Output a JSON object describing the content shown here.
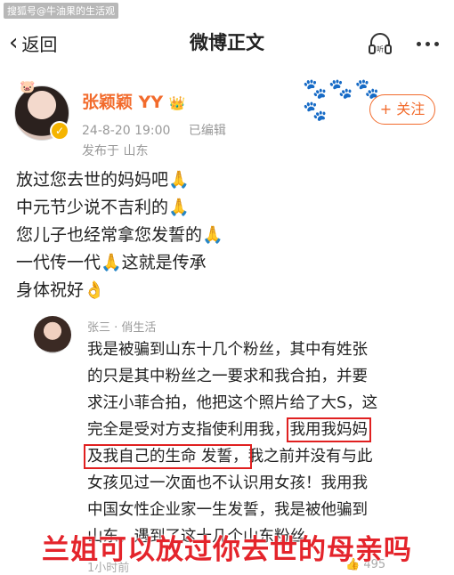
{
  "watermark": "搜狐号@牛油果的生活观",
  "nav": {
    "back_label": "返回",
    "title": "微博正文",
    "listen_label": "听"
  },
  "author": {
    "name": "张颖颖 YY",
    "crown": "👑",
    "time": "24-8-20 19:00",
    "edited": "已编辑",
    "from": "发布于 山东",
    "follow_label": "+ 关注",
    "decor": "🐾🐾🐾🐾"
  },
  "post": {
    "lines": [
      "放过您去世的妈妈吧🙏",
      "中元节少说不吉利的🙏",
      "您儿子也经常拿您发誓的🙏",
      "一代传一代🙏这就是传承",
      "身体祝好👌"
    ]
  },
  "comment": {
    "name": "张三 · 俏生活",
    "line1": "我是被骗到山东十几个粉丝，其中有姓张",
    "line2": "的只是其中粉丝之一要求和我合拍，并要",
    "line3": "求汪小菲合拍，他把这个照片给了大S，这",
    "line4a": "完全是受对方支指使利用我，",
    "line4b": "我用我妈妈",
    "line5a": "及我自己的生命 发誓，",
    "line5b": "我之前并没有与此",
    "line6": "女孩见过一次面也不认识用女孩！我用我",
    "line7": "中国女性企业家一生发誓，我是被他骗到",
    "line8": "山东，遇到了这十几个山东粉丝",
    "footer_time": "1小时前",
    "likes": "495"
  },
  "caption": "兰姐可以放过你去世的母亲吗",
  "colors": {
    "accent": "#f26b2c",
    "highlight": "#e02020",
    "caption": "#e4242b"
  }
}
